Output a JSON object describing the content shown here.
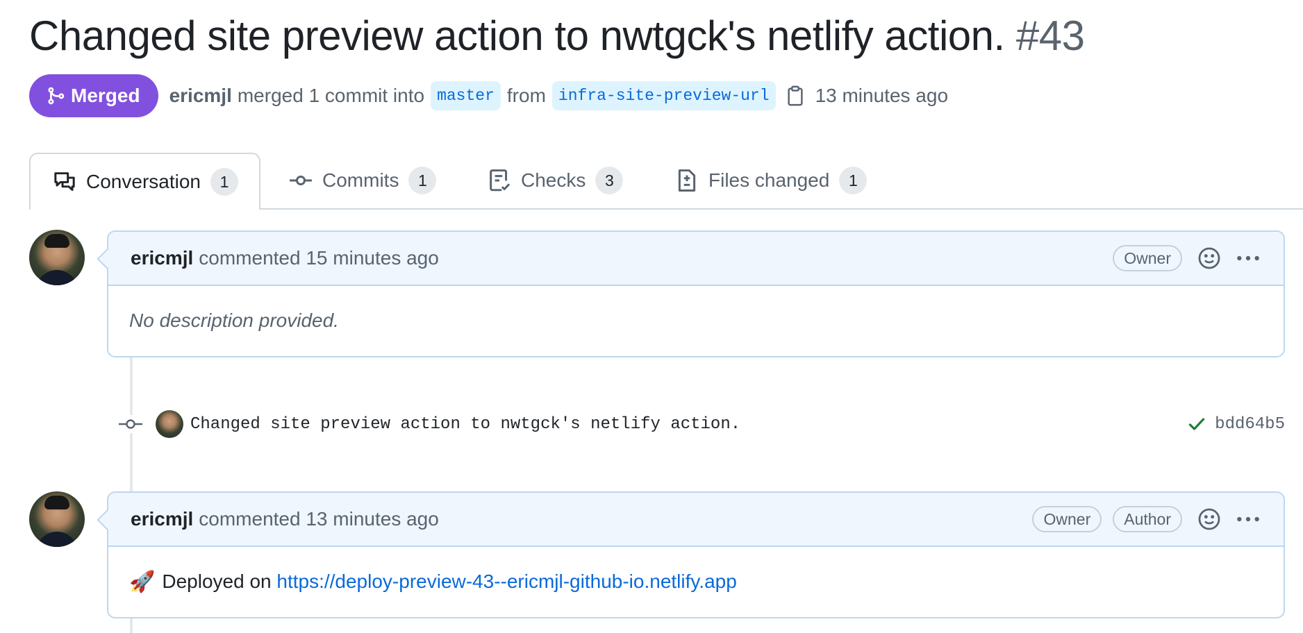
{
  "pr": {
    "title": "Changed site preview action to nwtgck's netlify action.",
    "number": "#43",
    "state": "Merged",
    "author": "ericmjl",
    "action_text": "merged 1 commit into",
    "base_branch": "master",
    "from_text": "from",
    "head_branch": "infra-site-preview-url",
    "time": "13 minutes ago"
  },
  "tabs": [
    {
      "label": "Conversation",
      "count": "1",
      "icon": "comment-discussion-icon",
      "active": true
    },
    {
      "label": "Commits",
      "count": "1",
      "icon": "git-commit-icon"
    },
    {
      "label": "Checks",
      "count": "3",
      "icon": "checklist-icon"
    },
    {
      "label": "Files changed",
      "count": "1",
      "icon": "file-diff-icon"
    }
  ],
  "comments": [
    {
      "author": "ericmjl",
      "meta": "commented 15 minutes ago",
      "labels": [
        "Owner"
      ],
      "body": "No description provided."
    },
    {
      "author": "ericmjl",
      "meta": "commented 13 minutes ago",
      "labels": [
        "Owner",
        "Author"
      ],
      "body_prefix": "Deployed on",
      "link": "https://deploy-preview-43--ericmjl-github-io.netlify.app"
    }
  ],
  "commit": {
    "message": "Changed site preview action to nwtgck's netlify action.",
    "sha": "bdd64b5",
    "status": "success"
  },
  "colors": {
    "merged": "#8250df",
    "link": "#0969da",
    "success": "#1a7f37",
    "comment_header_bg": "#eff6fe"
  }
}
